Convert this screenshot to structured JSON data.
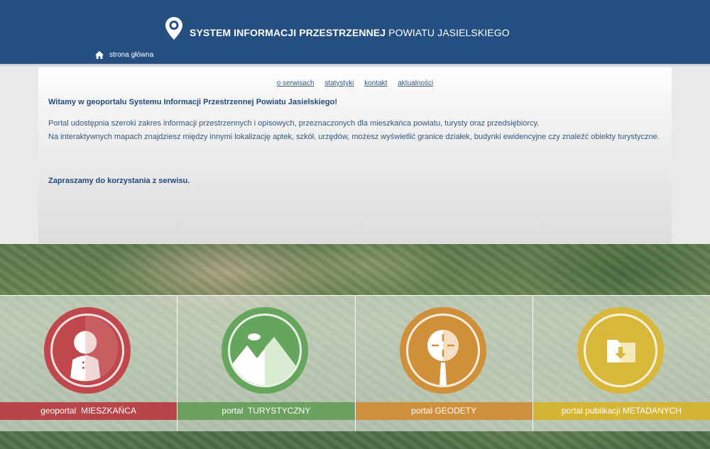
{
  "header": {
    "title_bold": "SYSTEM INFORMACJI PRZESTRZENNEJ",
    "title_rest": "POWIATU JASIELSKIEGO",
    "home_label": "strona główna"
  },
  "nav": {
    "links": [
      "o serwisach",
      "statystyki",
      "kontakt",
      "aktualności"
    ]
  },
  "content": {
    "welcome": "Witamy w geoportalu Systemu Informacji Przestrzennej Powiatu Jasielskiego!",
    "body_line1": "Portal udostępnia szeroki zakres informacji przestrzennych i opisowych, przeznaczonych dla mieszkańca powiatu, turysty oraz przedsiębiorcy.",
    "body_line2": "Na interaktywnych mapach znajdziesz między innymi lokalizację aptek, szkół, urzędów, możesz wyświetlić granice działek, budynki ewidencyjne czy znaleźć obiekty turystyczne.",
    "invite": "Zapraszamy do korzystania z serwisu."
  },
  "portals": [
    {
      "prefix": "geoportal",
      "highlight": "MIESZKAŃCA",
      "icon": "person-icon",
      "color": "#b9444a",
      "circle_color": "#c0484c"
    },
    {
      "prefix": "portal",
      "highlight": "TURYSTYCZNY",
      "icon": "mountain-icon",
      "color": "#6ba15f",
      "circle_color": "#66a55d"
    },
    {
      "prefix": "portal",
      "highlight": "GEODETY",
      "icon": "theodolite-icon",
      "color": "#cf8f3d",
      "circle_color": "#d0903a"
    },
    {
      "prefix": "portal publikacji",
      "highlight": "METADANYCH",
      "icon": "folder-download-icon",
      "color": "#d5b436",
      "circle_color": "#d8b73a"
    }
  ],
  "colors": {
    "header_bg": "#254f80",
    "link": "#34587e",
    "text": "#22497a"
  }
}
